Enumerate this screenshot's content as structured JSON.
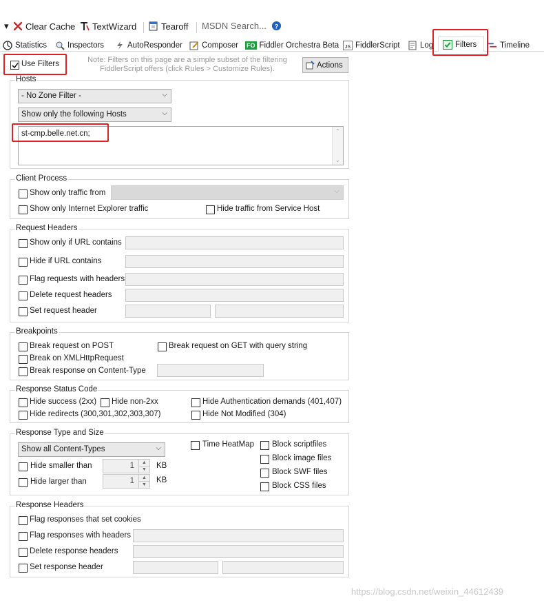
{
  "toolbar": {
    "clear_cache": "Clear Cache",
    "text_wizard": "TextWizard",
    "tearoff": "Tearoff",
    "msdn_search": "MSDN Search..."
  },
  "tabs": {
    "statistics": "Statistics",
    "inspectors": "Inspectors",
    "autoresponder": "AutoResponder",
    "composer": "Composer",
    "fiddler_orchestra": "Fiddler Orchestra Beta",
    "fiddlerscript": "FiddlerScript",
    "log": "Log",
    "filters": "Filters",
    "timeline": "Timeline",
    "fo_badge": "FO",
    "js_badge": "JS"
  },
  "top": {
    "use_filters": "Use Filters",
    "note_line1": "Note: Filters on this page are a simple subset of the filtering",
    "note_line2": "FiddlerScript offers (click Rules > Customize Rules).",
    "actions": "Actions"
  },
  "hosts": {
    "title": "Hosts",
    "zone_filter": "- No Zone Filter -",
    "host_filter": "Show only the following Hosts",
    "host_list": "st-cmp.belle.net.cn;"
  },
  "client_process": {
    "title": "Client Process",
    "show_only_traffic_from": "Show only traffic from",
    "show_only_ie": "Show only Internet Explorer traffic",
    "hide_service_host": "Hide traffic from Service Host"
  },
  "request_headers": {
    "title": "Request Headers",
    "show_if_url": "Show only if URL contains",
    "hide_if_url": "Hide if URL contains",
    "flag_with_headers": "Flag requests with headers",
    "delete_headers": "Delete request headers",
    "set_header": "Set request header"
  },
  "breakpoints": {
    "title": "Breakpoints",
    "on_post": "Break request on POST",
    "on_get_query": "Break request on GET with query string",
    "on_xhr": "Break on XMLHttpRequest",
    "on_content_type": "Break response on Content-Type"
  },
  "response_status": {
    "title": "Response Status Code",
    "hide_success": "Hide success (2xx)",
    "hide_non_2xx": "Hide non-2xx",
    "hide_auth": "Hide Authentication demands (401,407)",
    "hide_redirects": "Hide redirects (300,301,302,303,307)",
    "hide_not_modified": "Hide Not Modified (304)"
  },
  "response_type": {
    "title": "Response Type and Size",
    "content_types": "Show all Content-Types",
    "time_heatmap": "Time HeatMap",
    "block_script": "Block scriptfiles",
    "block_image": "Block image files",
    "block_swf": "Block SWF files",
    "block_css": "Block CSS files",
    "hide_smaller": "Hide smaller than",
    "hide_larger": "Hide larger than",
    "smaller_value": "1",
    "larger_value": "1",
    "unit": "KB"
  },
  "response_headers": {
    "title": "Response Headers",
    "flag_cookies": "Flag responses that set cookies",
    "flag_with_headers": "Flag responses with headers",
    "delete_headers": "Delete response headers",
    "set_header": "Set response header"
  },
  "watermark": "https://blog.csdn.net/weixin_44612439",
  "colors": {
    "highlight_red": "#e02020",
    "check_green": "#1a9e3a",
    "info_blue": "#1f5fbf"
  }
}
